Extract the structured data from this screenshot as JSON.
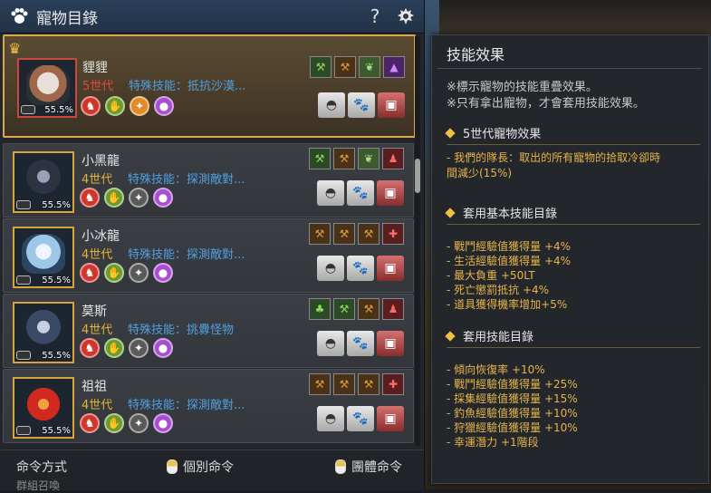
{
  "window": {
    "title": "寵物目錄",
    "help_label": "?"
  },
  "pets": [
    {
      "name": "貍貍",
      "generation": "5世代",
      "generation_color": "#e04b3a",
      "skill": "特殊技能：抵抗沙漠...",
      "percent": "55.5%",
      "selected": true
    },
    {
      "name": "小黑龍",
      "generation": "4世代",
      "skill": "特殊技能：探測敵對...",
      "percent": "55.5%"
    },
    {
      "name": "小冰龍",
      "generation": "4世代",
      "skill": "特殊技能：探測敵對...",
      "percent": "55.5%"
    },
    {
      "name": "莫斯",
      "generation": "4世代",
      "skill": "特殊技能：挑釁怪物",
      "percent": "55.5%"
    },
    {
      "name": "祖祖",
      "generation": "4世代",
      "skill": "特殊技能：探測敵對...",
      "percent": "55.5%"
    }
  ],
  "footer": {
    "command_mode": "命令方式",
    "individual_command": "個別命令",
    "group_command": "團體命令",
    "partial_label": "群組召喚"
  },
  "tooltip": {
    "title": "技能效果",
    "note1": "※標示寵物的技能重疊效果。",
    "note2": "※只有拿出寵物，才會套用技能效果。",
    "section1": {
      "title": "5世代寵物效果",
      "items": [
        "- 我們的隊長：取出的所有寵物的拾取冷卻時",
        "間減少(15%)"
      ]
    },
    "section2": {
      "title": "套用基本技能目錄",
      "items": [
        "- 戰鬥經驗值獲得量 +4%",
        "- 生活經驗值獲得量 +4%",
        "- 最大負重 +50LT",
        "- 死亡懲罰抵抗 +4%",
        "- 道具獲得機率增加+5%"
      ]
    },
    "section3": {
      "title": "套用技能目錄",
      "items": [
        "- 傾向恢復率 +10%",
        "- 戰鬥經驗值獲得量 +25%",
        "- 採集經驗值獲得量 +15%",
        "- 釣魚經驗值獲得量 +10%",
        "- 狩獵經驗值獲得量 +10%",
        "- 幸運潛力 +1階段"
      ]
    }
  },
  "colors": {
    "accent_gold": "#d9a84a",
    "skill_blue": "#4fa0e0",
    "effect_orange": "#e8b54a"
  }
}
